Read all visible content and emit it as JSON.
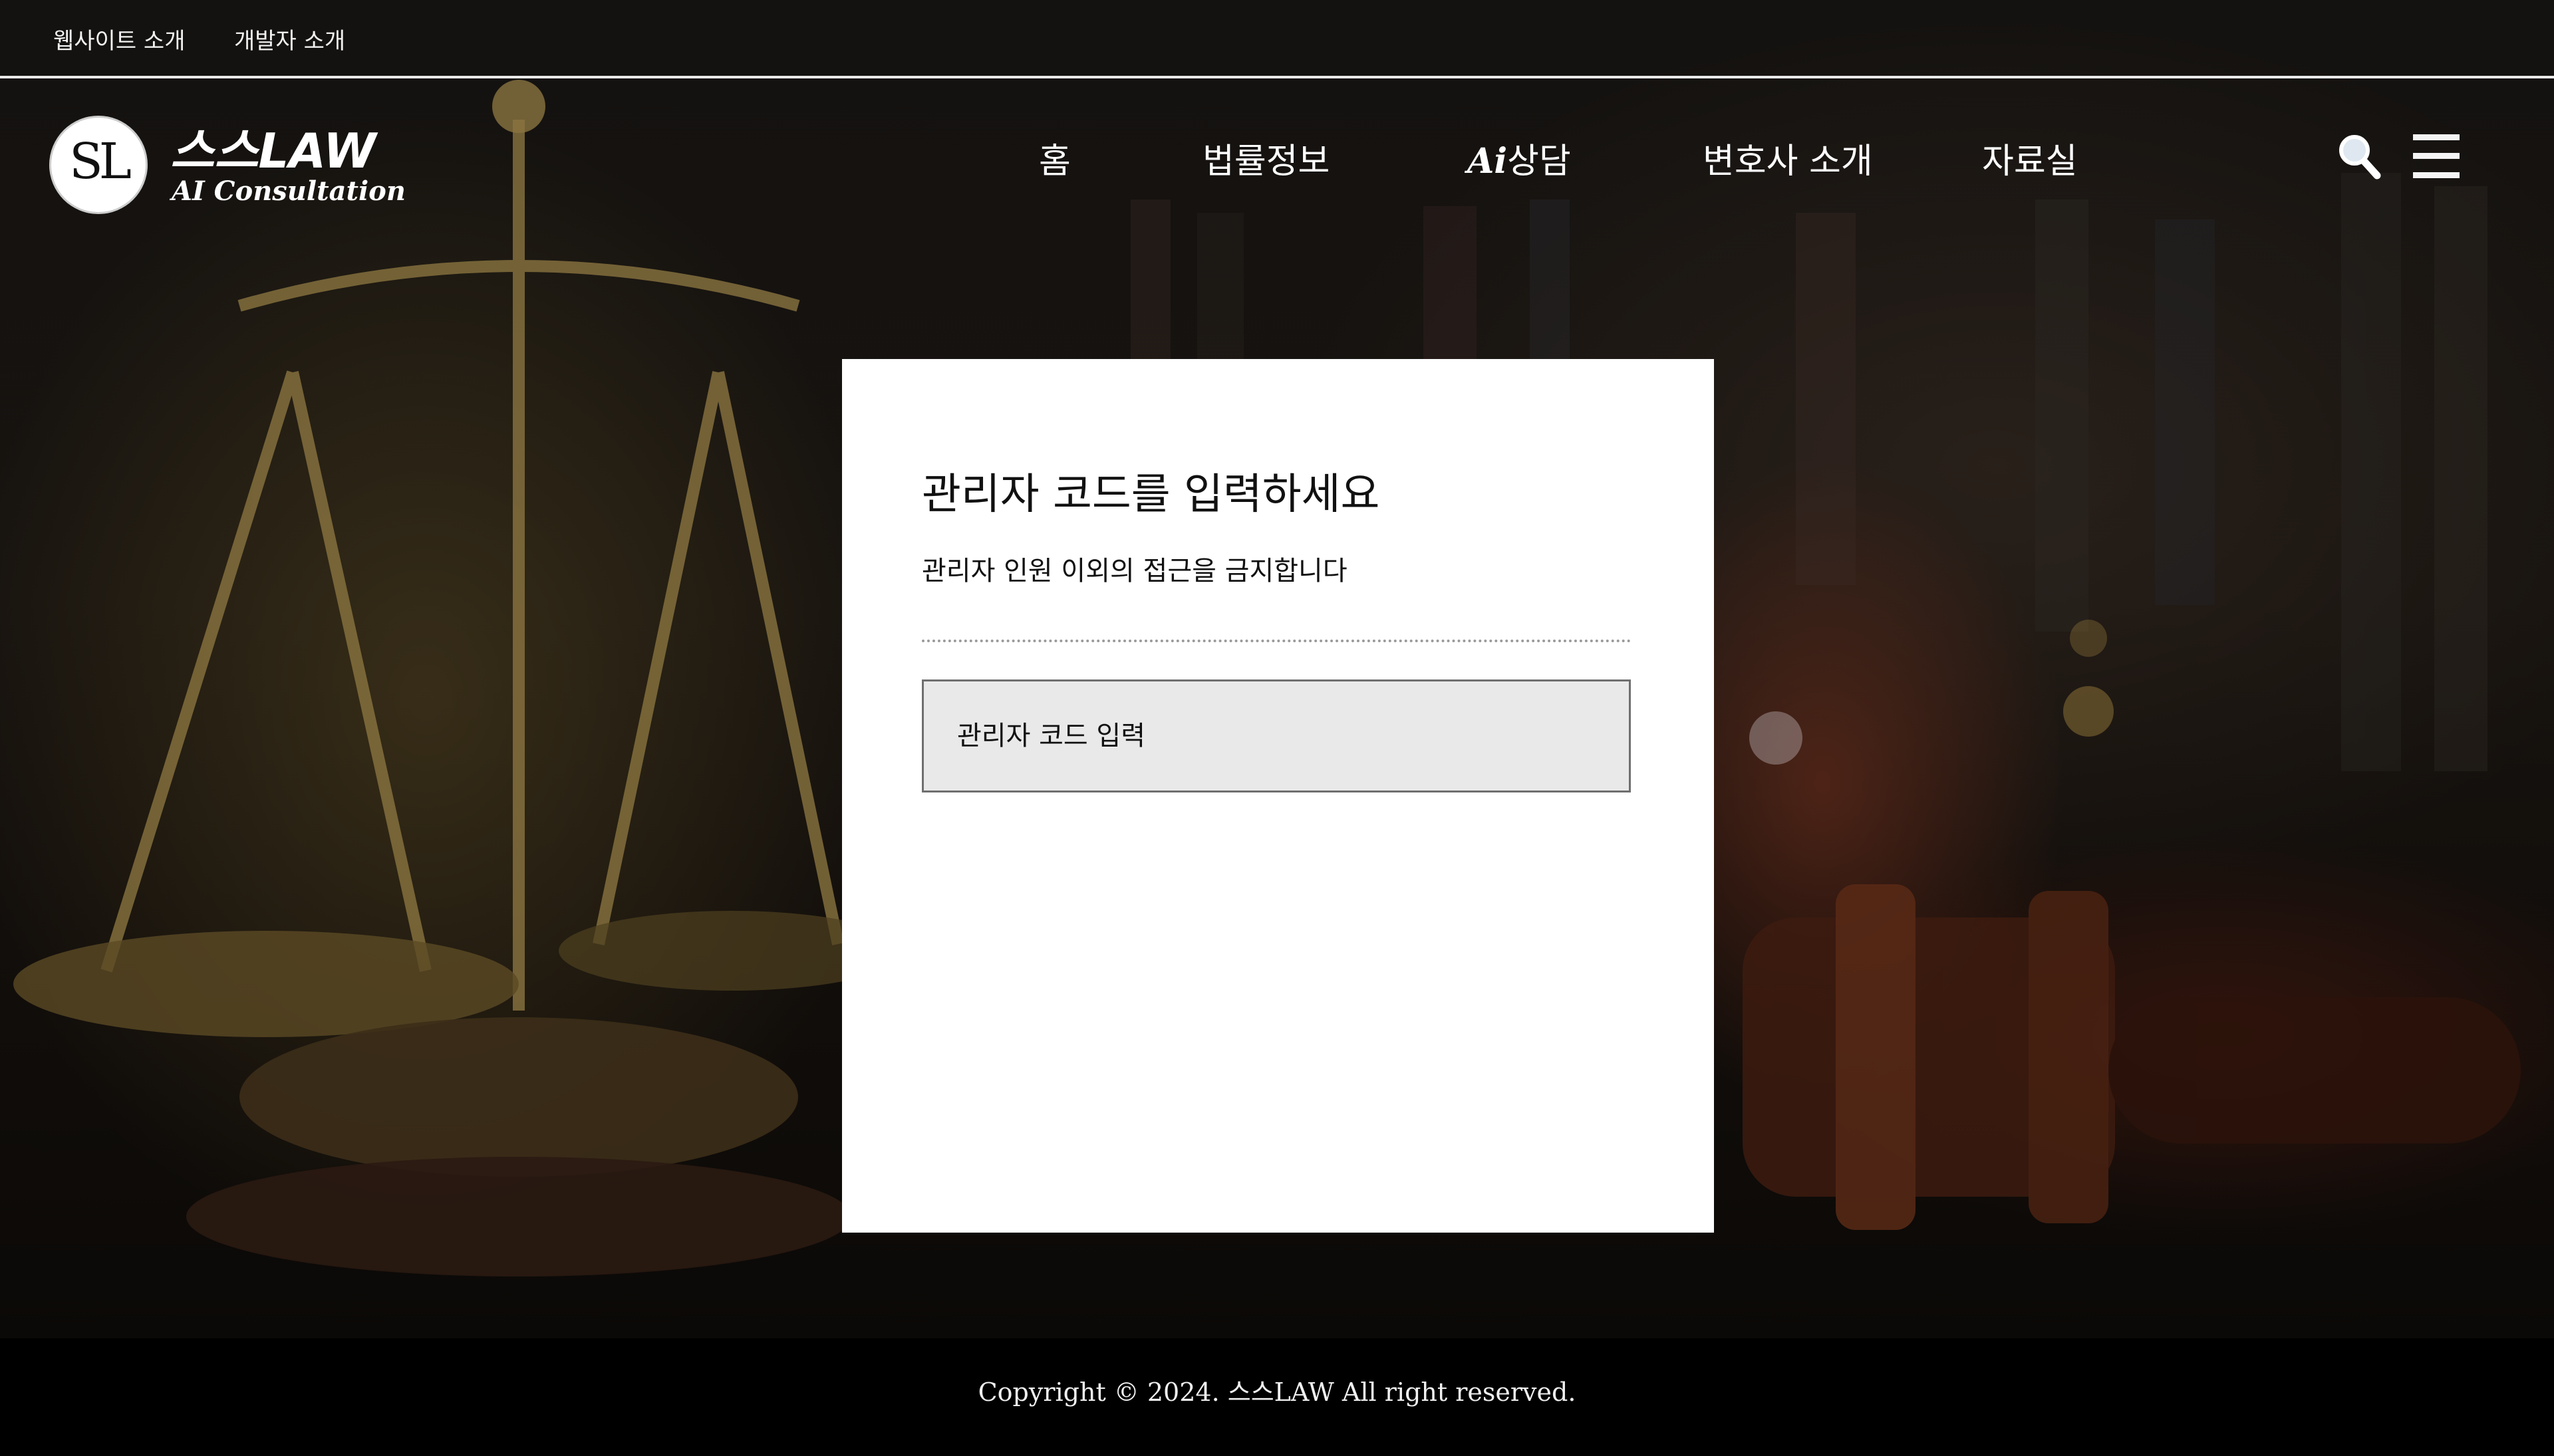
{
  "topbar": {
    "links": [
      "웹사이트 소개",
      "개발자 소개"
    ]
  },
  "logo": {
    "monogram": "SL",
    "title": "스스LAW",
    "subtitle": "AI Consultation"
  },
  "nav": {
    "items": [
      {
        "label": "홈"
      },
      {
        "label": "법률정보"
      },
      {
        "mark": "Ai",
        "label": "상담"
      },
      {
        "label": "변호사 소개"
      },
      {
        "label": "자료실"
      }
    ],
    "icons": [
      "search-icon",
      "menu-icon"
    ]
  },
  "admin": {
    "title": "관리자 코드를 입력하세요",
    "description": "관리자 인원 이외의 접근을 금지합니다",
    "input_placeholder": "관리자 코드 입력",
    "input_value": ""
  },
  "footer": {
    "text": "Copyright © 2024. 스스LAW All right reserved."
  },
  "colors": {
    "panel_bg": "#ffffff",
    "input_bg": "#e9e9e9",
    "footer_bg": "#000000",
    "text_light": "#ffffff"
  }
}
